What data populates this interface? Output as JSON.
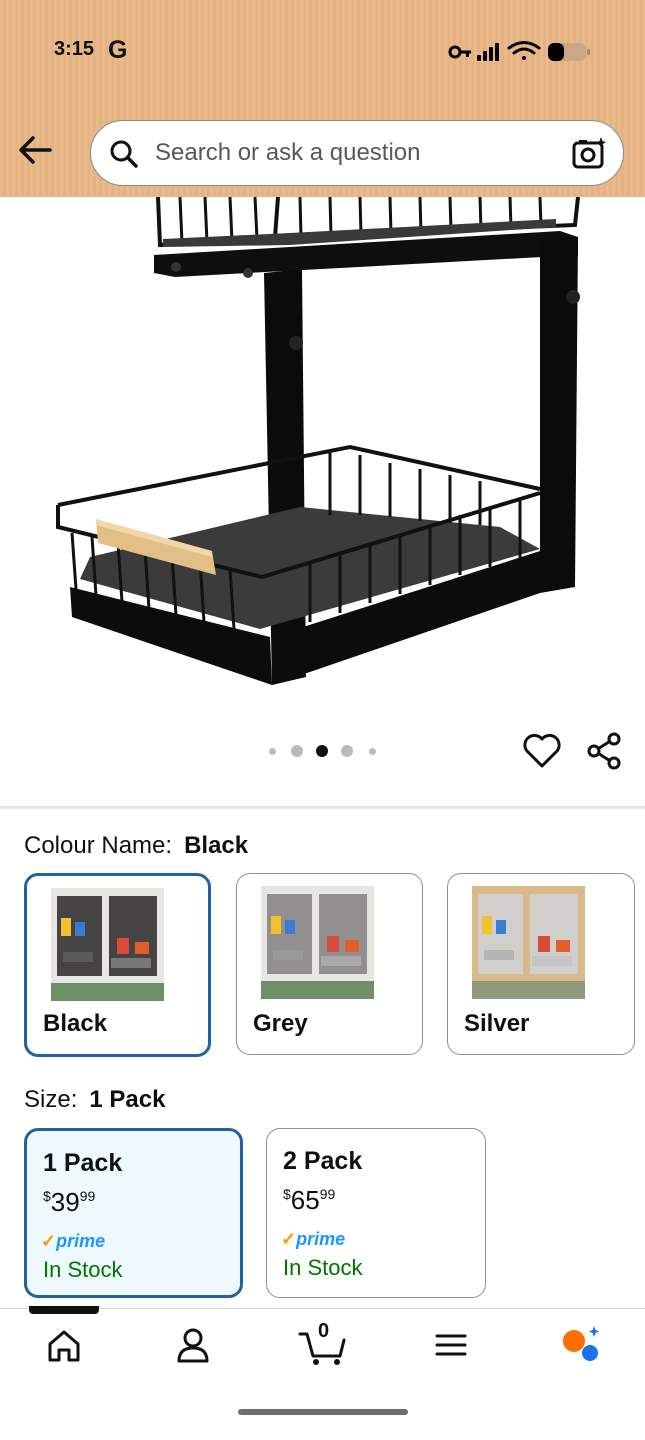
{
  "status": {
    "time": "3:15",
    "carrier_icon": "G"
  },
  "search": {
    "placeholder": "Search or ask a question"
  },
  "gallery": {
    "dot_count": 5,
    "active_dot": 3
  },
  "colour": {
    "label": "Colour Name:",
    "selected": "Black",
    "options": [
      {
        "name": "Black",
        "selected": true
      },
      {
        "name": "Grey",
        "selected": false
      },
      {
        "name": "Silver",
        "selected": false
      }
    ]
  },
  "size": {
    "label": "Size:",
    "selected": "1 Pack",
    "options": [
      {
        "title": "1 Pack",
        "currency": "$",
        "whole": "39",
        "fraction": "99",
        "prime": "prime",
        "stock": "In Stock",
        "selected": true
      },
      {
        "title": "2 Pack",
        "currency": "$",
        "whole": "65",
        "fraction": "99",
        "prime": "prime",
        "stock": "In Stock",
        "selected": false
      }
    ]
  },
  "nav": {
    "cart_count": "0",
    "items": [
      "home-icon",
      "account-icon",
      "cart-icon",
      "menu-icon",
      "assistant-icon"
    ]
  },
  "colors": {
    "accent": "#2162a1",
    "header": "#e9b98a",
    "prime_blue": "#1a98ff",
    "stock_green": "#007600"
  }
}
